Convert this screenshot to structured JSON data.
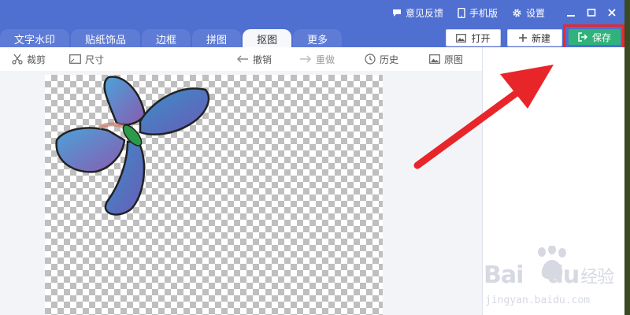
{
  "header": {
    "feedback_label": "意见反馈",
    "mobile_label": "手机版",
    "settings_label": "设置"
  },
  "tabs": [
    {
      "label": "文字水印",
      "active": false
    },
    {
      "label": "贴纸饰品",
      "active": false
    },
    {
      "label": "边框",
      "active": false
    },
    {
      "label": "拼图",
      "active": false
    },
    {
      "label": "抠图",
      "active": true
    },
    {
      "label": "更多",
      "active": false
    }
  ],
  "actions": {
    "open_label": "打开",
    "new_label": "新建",
    "save_label": "保存"
  },
  "toolbar": {
    "crop_label": "裁剪",
    "size_label": "尺寸",
    "undo_label": "撤销",
    "redo_label": "重做",
    "history_label": "历史",
    "original_label": "原图"
  },
  "watermark": {
    "brand": "Bai",
    "brand2": "du",
    "jingyan": "经验",
    "url": "jingyan.baidu.com"
  },
  "colors": {
    "titlebar": "#4f6fd1",
    "save_button": "#2fb37a",
    "highlight": "#e32b2b"
  }
}
